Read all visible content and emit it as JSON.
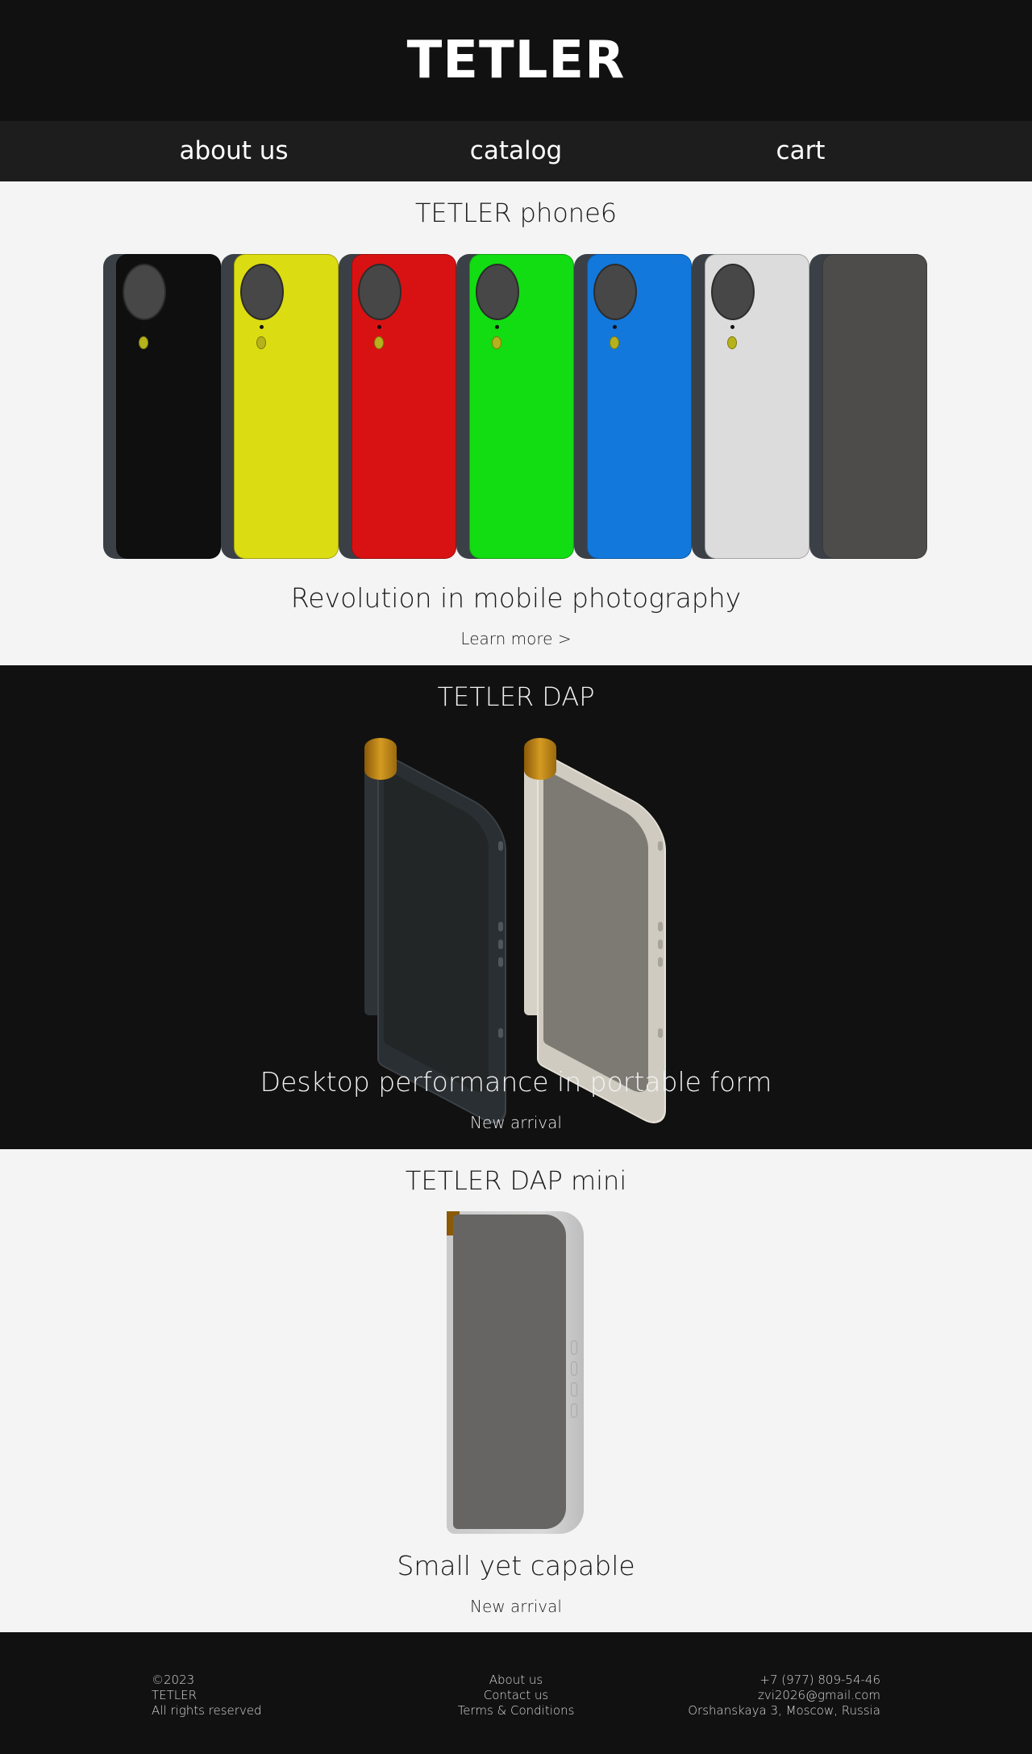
{
  "header": {
    "logo": "TETLER"
  },
  "nav": {
    "items": [
      {
        "label": "about us"
      },
      {
        "label": "catalog"
      },
      {
        "label": "cart"
      }
    ]
  },
  "products": [
    {
      "title": "TETLER phone6",
      "tagline": "Revolution in mobile photography",
      "link": "Learn more >",
      "variant_colors": [
        "#0f0f0f",
        "#dcdc12",
        "#d81212",
        "#12dc12",
        "#1278dc",
        "#dcdcdc",
        "#4e4c4a"
      ]
    },
    {
      "title": "TETLER DAP",
      "tagline": "Desktop performance in portable form",
      "link": "New arrival"
    },
    {
      "title": "TETLER DAP mini",
      "tagline": "Small yet capable",
      "link": "New arrival"
    }
  ],
  "footer": {
    "copyright": "©2023",
    "brand": "TETLER",
    "rights": "All rights reserved",
    "links": [
      "About us",
      "Contact us",
      "Terms & Conditions"
    ],
    "phone": "+7 (977) 809-54-46",
    "email": "zvi2026@gmail.com",
    "address": "Orshanskaya 3, Moscow, Russia"
  }
}
